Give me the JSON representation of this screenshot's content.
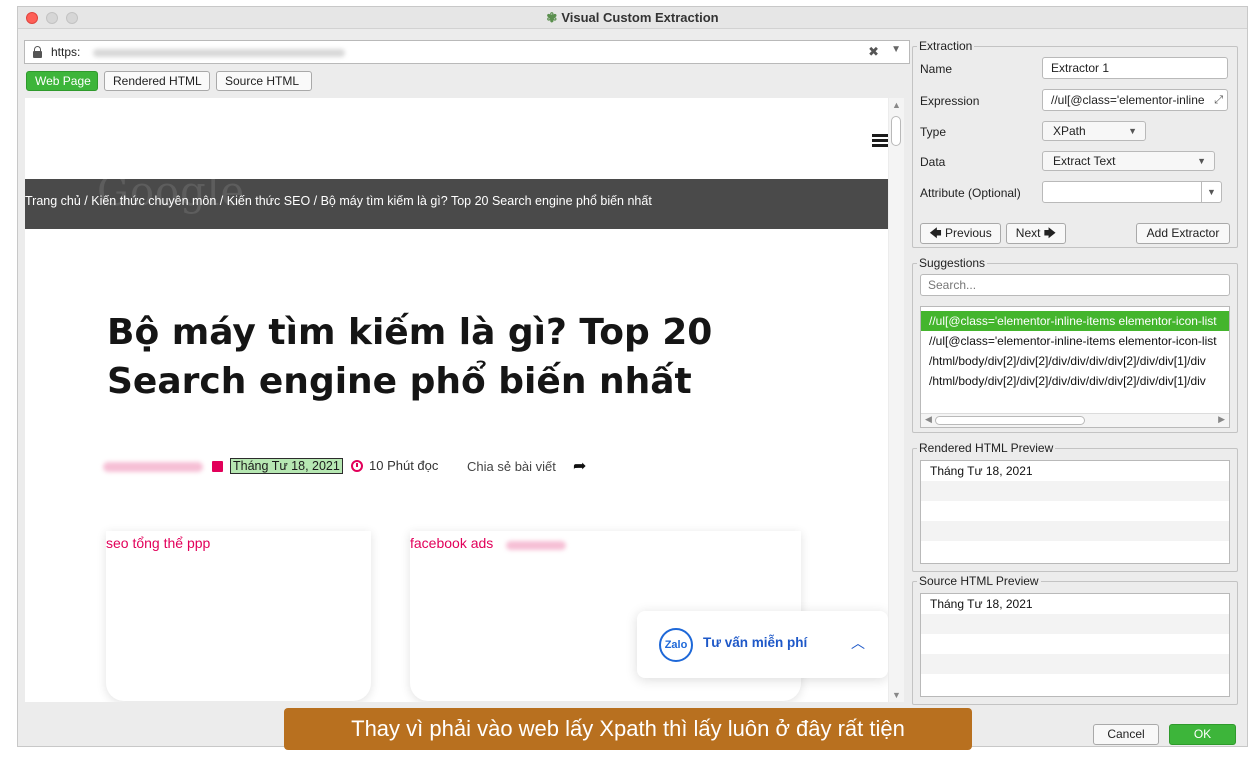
{
  "window": {
    "title": "Visual Custom Extraction"
  },
  "urlbar": {
    "scheme": "https:"
  },
  "view_tabs": [
    {
      "label": "Web Page",
      "active": true
    },
    {
      "label": "Rendered HTML",
      "active": false
    },
    {
      "label": "Source HTML",
      "active": false
    }
  ],
  "page": {
    "breadcrumb": "Trang chủ / Kiến thức chuyên môn / Kiến thức SEO / Bộ máy tìm kiếm là gì? Top 20 Search engine phổ biến nhất",
    "headline": "Bộ máy tìm kiếm là gì? Top 20 Search engine phổ biến nhất",
    "meta": {
      "date": "Tháng Tư 18, 2021",
      "read_time": "10 Phút đọc",
      "share": "Chia sẻ bài viết"
    },
    "cards": [
      {
        "title": "seo tổng thể ppp"
      },
      {
        "title": "facebook ads"
      }
    ],
    "zalo": {
      "badge": "Zalo",
      "label": "Tư vấn miễn phí"
    }
  },
  "extraction": {
    "group_label": "Extraction",
    "name_label": "Name",
    "name_value": "Extractor 1",
    "expression_label": "Expression",
    "expression_value": "//ul[@class='elementor-inline",
    "type_label": "Type",
    "type_value": "XPath",
    "data_label": "Data",
    "data_value": "Extract Text",
    "attribute_label": "Attribute (Optional)",
    "attribute_value": "",
    "previous_label": "Previous",
    "next_label": "Next",
    "add_label": "Add Extractor"
  },
  "suggestions": {
    "group_label": "Suggestions",
    "search_placeholder": "Search...",
    "items": [
      "//ul[@class='elementor-inline-items elementor-icon-list",
      "//ul[@class='elementor-inline-items elementor-icon-list",
      "/html/body/div[2]/div[2]/div/div/div/div[2]/div/div[1]/div",
      "/html/body/div[2]/div[2]/div/div/div/div[2]/div/div[1]/div"
    ],
    "selected_index": 0
  },
  "rendered_preview": {
    "group_label": "Rendered HTML Preview",
    "text": "Tháng Tư 18, 2021"
  },
  "source_preview": {
    "group_label": "Source HTML Preview",
    "text": "Tháng Tư 18, 2021"
  },
  "dialog": {
    "cancel_label": "Cancel",
    "ok_label": "OK"
  },
  "caption": "Thay vì phải vào web lấy Xpath thì lấy luôn ở đây rất tiện",
  "colors": {
    "accent_green": "#3db53a",
    "brand_pink": "#e2005a",
    "zalo_blue": "#1e58c8",
    "caption_bg": "#b8701f"
  }
}
